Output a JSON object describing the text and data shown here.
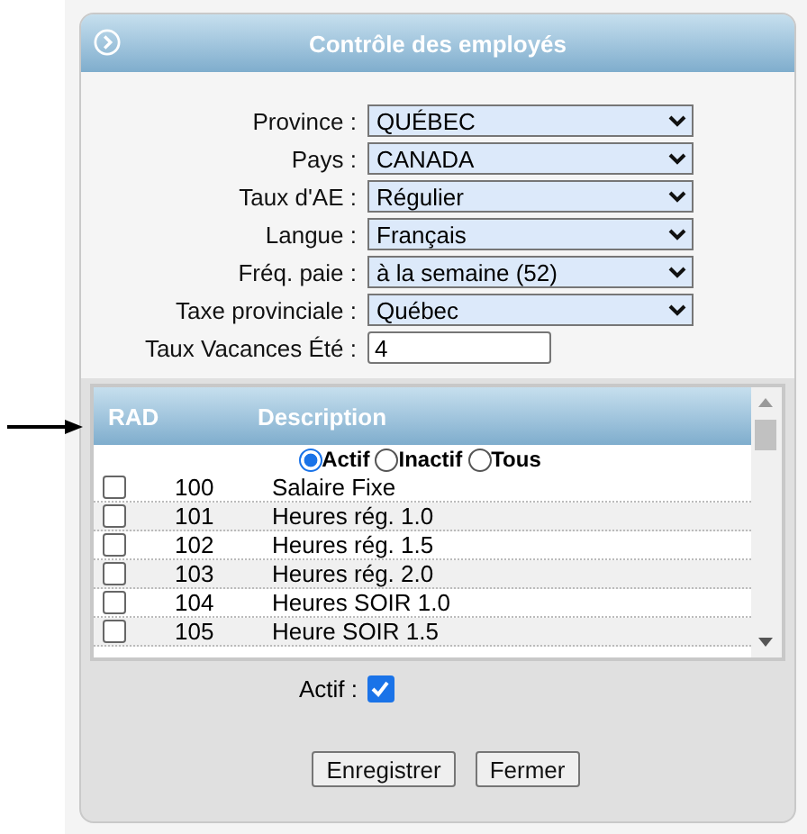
{
  "window": {
    "title": "Contrôle des employés"
  },
  "fields": [
    {
      "label": "Province :",
      "kind": "select",
      "value": "QUÉBEC"
    },
    {
      "label": "Pays :",
      "kind": "select",
      "value": "CANADA"
    },
    {
      "label": "Taux d'AE :",
      "kind": "select",
      "value": "Régulier"
    },
    {
      "label": "Langue :",
      "kind": "select",
      "value": "Français"
    },
    {
      "label": "Fréq. paie :",
      "kind": "select",
      "value": "à la semaine (52)"
    },
    {
      "label": "Taxe provinciale :",
      "kind": "select",
      "value": "Québec"
    },
    {
      "label": "Taux Vacances Été :",
      "kind": "text",
      "value": "4"
    }
  ],
  "table": {
    "columns": [
      "RAD",
      "Description"
    ],
    "filters": [
      {
        "label": "Actif",
        "selected": true
      },
      {
        "label": "Inactif",
        "selected": false
      },
      {
        "label": "Tous",
        "selected": false
      }
    ],
    "rows": [
      {
        "checked": false,
        "code": "100",
        "description": "Salaire Fixe"
      },
      {
        "checked": false,
        "code": "101",
        "description": "Heures rég. 1.0"
      },
      {
        "checked": false,
        "code": "102",
        "description": "Heures rég. 1.5"
      },
      {
        "checked": false,
        "code": "103",
        "description": "Heures rég. 2.0"
      },
      {
        "checked": false,
        "code": "104",
        "description": "Heures SOIR 1.0"
      },
      {
        "checked": false,
        "code": "105",
        "description": "Heure SOIR 1.5"
      }
    ]
  },
  "active": {
    "label": "Actif :",
    "checked": true
  },
  "buttons": [
    "Enregistrer",
    "Fermer"
  ]
}
